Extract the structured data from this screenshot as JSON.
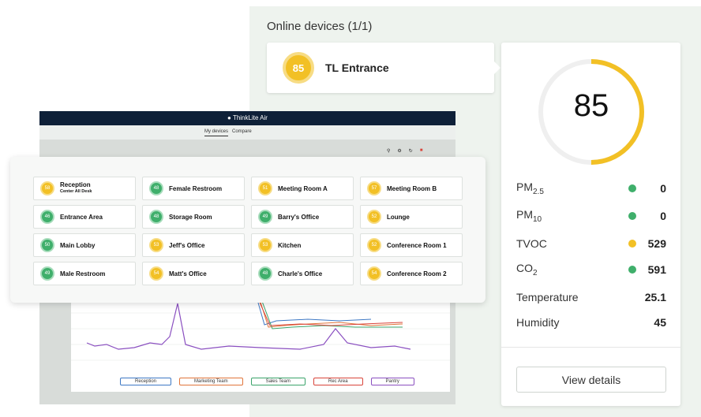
{
  "dashboard": {
    "brand": "ThinkLite Air",
    "tabs": [
      "My devices",
      "Compare"
    ],
    "icons": [
      "location-icon",
      "settings-icon",
      "refresh-icon",
      "alert-icon"
    ],
    "rooms": [
      {
        "score": "58",
        "name": "Reception",
        "sub": "Center All Desk",
        "status": "yellow"
      },
      {
        "score": "48",
        "name": "Female Restroom",
        "status": "green"
      },
      {
        "score": "51",
        "name": "Meeting Room A",
        "status": "yellow"
      },
      {
        "score": "57",
        "name": "Meeting Room B",
        "status": "yellow"
      },
      {
        "score": "46",
        "name": "Entrance  Area",
        "status": "green"
      },
      {
        "score": "48",
        "name": "Storage Room",
        "status": "green"
      },
      {
        "score": "49",
        "name": "Barry's  Office",
        "status": "green"
      },
      {
        "score": "52",
        "name": "Lounge",
        "status": "yellow"
      },
      {
        "score": "50",
        "name": "Main Lobby",
        "status": "green"
      },
      {
        "score": "53",
        "name": "Jeff's Office",
        "status": "yellow"
      },
      {
        "score": "53",
        "name": "Kitchen",
        "status": "yellow"
      },
      {
        "score": "52",
        "name": "Conference Room 1",
        "status": "yellow"
      },
      {
        "score": "49",
        "name": "Male Restroom",
        "status": "green"
      },
      {
        "score": "54",
        "name": "Matt's Office",
        "status": "yellow"
      },
      {
        "score": "48",
        "name": "Charle's Office",
        "status": "green"
      },
      {
        "score": "54",
        "name": "Conference Room 2",
        "status": "yellow"
      }
    ],
    "legend": [
      {
        "label": "Reception",
        "color": "#3d78c4"
      },
      {
        "label": "Marketing Team",
        "color": "#e0743a"
      },
      {
        "label": "Sales Team",
        "color": "#3aa36a"
      },
      {
        "label": "Rec Area",
        "color": "#d9443a"
      },
      {
        "label": "Pantry",
        "color": "#8a4fc0"
      }
    ]
  },
  "online": {
    "title": "Online devices (1/1)",
    "device": {
      "score": "85",
      "name": "TL Entrance"
    }
  },
  "detail": {
    "score": "85",
    "score_fraction": 0.5,
    "gauge_color": "#f2c025",
    "metrics": [
      {
        "label": "PM",
        "sub": "2.5",
        "value": "0",
        "dot": "#3faf6b"
      },
      {
        "label": "PM",
        "sub": "10",
        "value": "0",
        "dot": "#3faf6b"
      },
      {
        "label": "TVOC",
        "sub": "",
        "value": "529",
        "dot": "#f2c025"
      },
      {
        "label": "CO",
        "sub": "2",
        "value": "591",
        "dot": "#3faf6b"
      },
      {
        "label": "Temperature",
        "sub": "",
        "value": "25.1",
        "dot": ""
      },
      {
        "label": "Humidity",
        "sub": "",
        "value": "45",
        "dot": ""
      }
    ],
    "button": "View details"
  }
}
